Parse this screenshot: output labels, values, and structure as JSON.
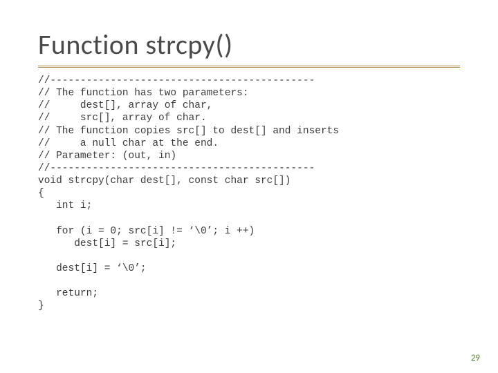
{
  "title": "Function strcpy()",
  "code_lines": [
    "//--------------------------------------------",
    "// The function has two parameters:",
    "//     dest[], array of char,",
    "//     src[], array of char.",
    "// The function copies src[] to dest[] and inserts",
    "//     a null char at the end.",
    "// Parameter: (out, in)",
    "//--------------------------------------------",
    "void strcpy(char dest[], const char src[])",
    "{",
    "   int i;",
    "",
    "   for (i = 0; src[i] != ‘\\0’; i ++)",
    "      dest[i] = src[i];",
    "",
    "   dest[i] = ‘\\0’;",
    "",
    "   return;",
    "}"
  ],
  "page_number": "29"
}
